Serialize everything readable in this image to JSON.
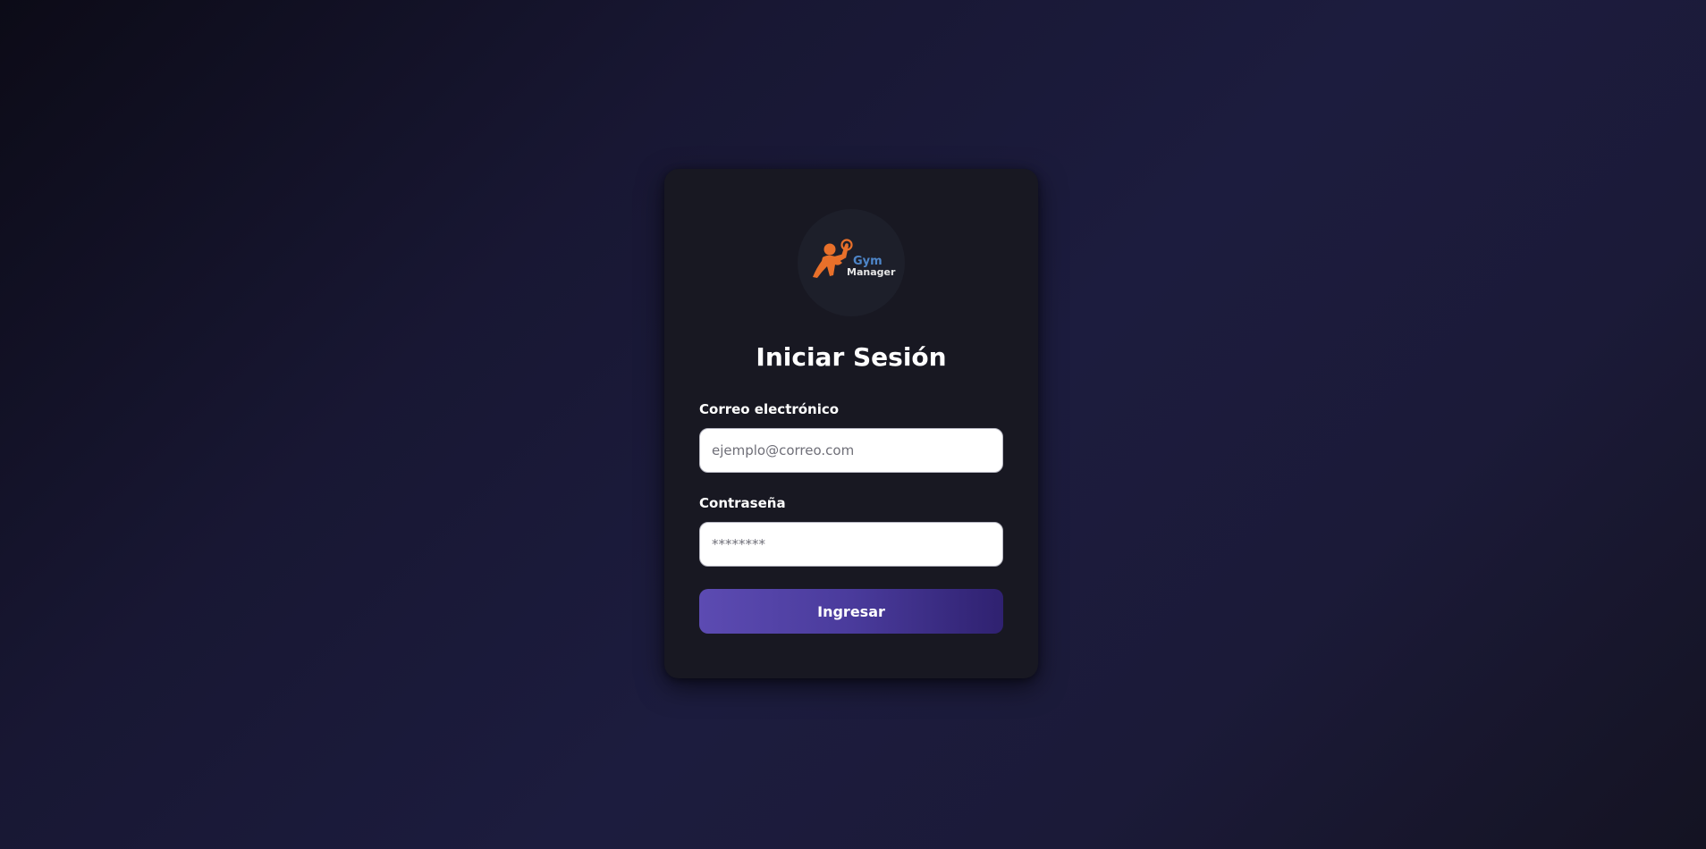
{
  "logo": {
    "icon": "weightlifter-icon",
    "line1": "Gym",
    "line2": "Manager",
    "colors": {
      "figure": "#e8702a",
      "line1": "#4e86c9",
      "line2": "#e6e6e6"
    }
  },
  "title": "Iniciar Sesión",
  "form": {
    "email_label": "Correo electrónico",
    "email_placeholder": "ejemplo@correo.com",
    "email_value": "",
    "password_label": "Contraseña",
    "password_placeholder": "********",
    "password_value": "",
    "submit_label": "Ingresar"
  },
  "colors": {
    "card_bg": "#181822",
    "button_start": "#5c4bb2",
    "button_end": "#2f2170"
  }
}
